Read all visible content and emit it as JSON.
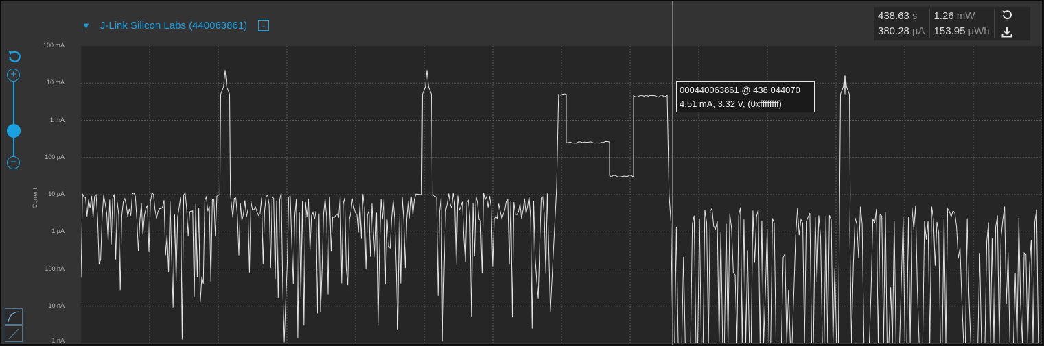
{
  "device": {
    "name": "J-Link Silicon Labs (440063861)"
  },
  "stats": {
    "time_value": "438.63",
    "time_unit": "s",
    "avg_current_value": "380.28",
    "avg_current_unit": "µA",
    "power_value": "1.26",
    "power_unit": "mW",
    "energy_value": "153.95",
    "energy_unit": "µWh"
  },
  "tooltip": {
    "line1": "000440063861 @ 438.044070",
    "line2": "4.51 mA, 3.32 V, (0xffffffff)"
  },
  "chart_data": {
    "type": "line",
    "title": "",
    "ylabel": "Current",
    "y_scale": "log",
    "ylim": [
      "1 nA",
      "100 mA"
    ],
    "y_tick_labels": [
      "100 mA",
      "10 mA",
      "1 mA",
      "100 µA",
      "10 µA",
      "1 µA",
      "100 nA",
      "10 nA",
      "1 nA"
    ],
    "x_grid_lines": 14,
    "grid": true,
    "series": [
      {
        "color": "#e6e6e6",
        "segments": [
          {
            "kind": "noise",
            "from": 0.0,
            "to": 0.143,
            "level": "1 µA–10 µA"
          },
          {
            "kind": "spike",
            "at": 0.15,
            "peak": "~20 mA"
          },
          {
            "kind": "noise",
            "from": 0.158,
            "to": 0.35,
            "level": "1 µA–10 µA"
          },
          {
            "kind": "spike",
            "at": 0.36,
            "peak": "~20 mA"
          },
          {
            "kind": "noise",
            "from": 0.37,
            "to": 0.49,
            "level": "1 µA–10 µA"
          },
          {
            "kind": "plateau",
            "from": 0.495,
            "to": 0.505,
            "level": "5 mA"
          },
          {
            "kind": "plateau",
            "from": 0.505,
            "to": 0.55,
            "level": "~250 µA"
          },
          {
            "kind": "plateau",
            "from": 0.55,
            "to": 0.575,
            "level": "~30 µA"
          },
          {
            "kind": "plateau",
            "from": 0.575,
            "to": 0.61,
            "level": "4.51 mA"
          },
          {
            "kind": "noise",
            "from": 0.61,
            "to": 0.79,
            "level": "1 nA–5 µA"
          },
          {
            "kind": "spike",
            "at": 0.795,
            "peak": "5 mA"
          },
          {
            "kind": "noise",
            "from": 0.8,
            "to": 1.0,
            "level": "1 nA–5 µA"
          }
        ]
      }
    ]
  },
  "icons": {
    "reset_zoom": "reset-icon",
    "zoom_in": "zoom-in-icon",
    "zoom_out": "zoom-out-icon",
    "stats_reset": "reset-icon",
    "stats_download": "download-icon",
    "collapse": "triangle-down-icon",
    "dropdown": "chevron-down-icon",
    "mode_curve": "curve-mode-icon",
    "mode_line": "line-mode-icon"
  },
  "colors": {
    "accent": "#1ba1e2",
    "plot_bg": "#262626",
    "trace": "#e6e6e6"
  }
}
